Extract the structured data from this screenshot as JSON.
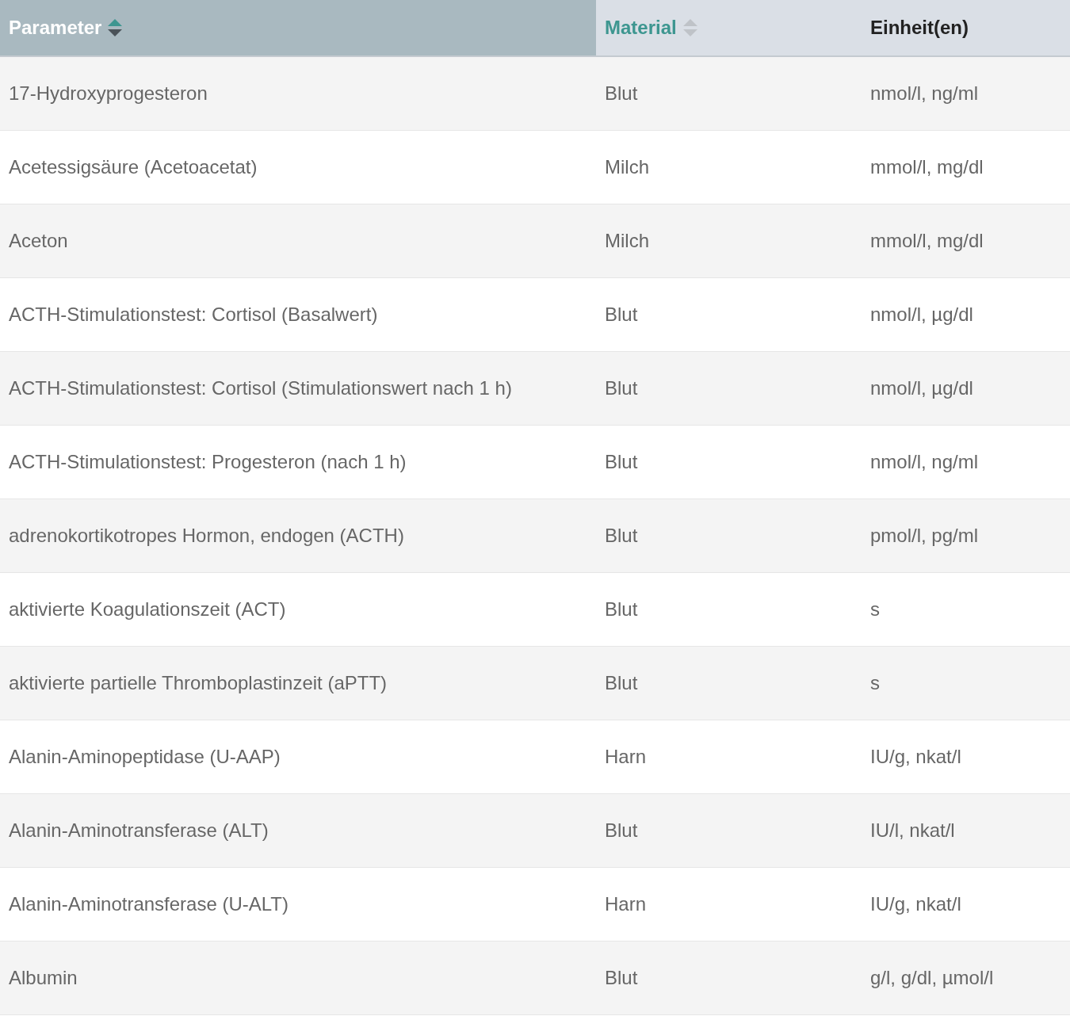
{
  "table": {
    "columns": [
      {
        "label": "Parameter",
        "sortable": true,
        "selected": true
      },
      {
        "label": "Material",
        "sortable": true,
        "selected": false
      },
      {
        "label": "Einheit(en)",
        "sortable": false,
        "selected": false
      }
    ],
    "rows": [
      [
        "17-Hydroxyprogesteron",
        "Blut",
        "nmol/l, ng/ml"
      ],
      [
        "Acetessigsäure (Acetoacetat)",
        "Milch",
        "mmol/l, mg/dl"
      ],
      [
        "Aceton",
        "Milch",
        "mmol/l, mg/dl"
      ],
      [
        "ACTH-Stimulationstest: Cortisol (Basalwert)",
        "Blut",
        "nmol/l, µg/dl"
      ],
      [
        "ACTH-Stimulationstest: Cortisol (Stimulationswert nach 1 h)",
        "Blut",
        "nmol/l, µg/dl"
      ],
      [
        "ACTH-Stimulationstest: Progesteron (nach 1 h)",
        "Blut",
        "nmol/l, ng/ml"
      ],
      [
        "adrenokortikotropes Hormon, endogen (ACTH)",
        "Blut",
        "pmol/l, pg/ml"
      ],
      [
        "aktivierte Koagulationszeit (ACT)",
        "Blut",
        "s"
      ],
      [
        "aktivierte partielle Thromboplastinzeit (aPTT)",
        "Blut",
        "s"
      ],
      [
        "Alanin-Aminopeptidase (U-AAP)",
        "Harn",
        "IU/g, nkat/l"
      ],
      [
        "Alanin-Aminotransferase (ALT)",
        "Blut",
        "IU/l, nkat/l"
      ],
      [
        "Alanin-Aminotransferase (U-ALT)",
        "Harn",
        "IU/g, nkat/l"
      ],
      [
        "Albumin",
        "Blut",
        "g/l, g/dl, µmol/l"
      ]
    ]
  }
}
